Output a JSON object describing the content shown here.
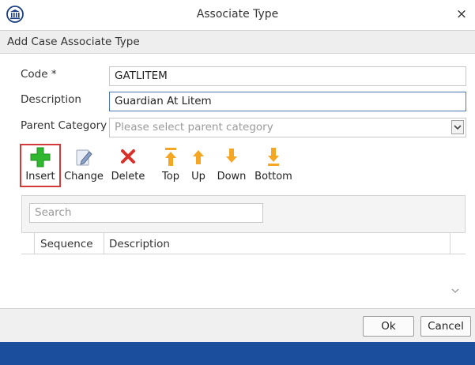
{
  "window": {
    "title": "Associate Type",
    "close_glyph": "×"
  },
  "subheader": {
    "title": "Add Case Associate Type"
  },
  "form": {
    "code": {
      "label": "Code *",
      "value": "GATLITEM"
    },
    "description": {
      "label": "Description",
      "value": "Guardian At Litem"
    },
    "parent_category": {
      "label": "Parent Category",
      "placeholder": "Please select parent category"
    }
  },
  "toolbar": {
    "insert": {
      "label": "Insert",
      "icon": "plus-icon"
    },
    "change": {
      "label": "Change",
      "icon": "edit-icon"
    },
    "delete": {
      "label": "Delete",
      "icon": "delete-x-icon"
    },
    "top": {
      "label": "Top",
      "icon": "arrow-top-icon"
    },
    "up": {
      "label": "Up",
      "icon": "arrow-up-icon"
    },
    "down": {
      "label": "Down",
      "icon": "arrow-down-icon"
    },
    "bottom": {
      "label": "Bottom",
      "icon": "arrow-bottom-icon"
    }
  },
  "list": {
    "search_placeholder": "Search",
    "columns": [
      "Sequence",
      "Description"
    ]
  },
  "buttons": {
    "ok": "Ok",
    "cancel": "Cancel"
  },
  "colors": {
    "accent": "#1b4f9e",
    "highlight": "#d43a3a",
    "insert_green": "#2fb82f",
    "delete_red": "#d9302a",
    "arrow_orange": "#f5a623"
  }
}
